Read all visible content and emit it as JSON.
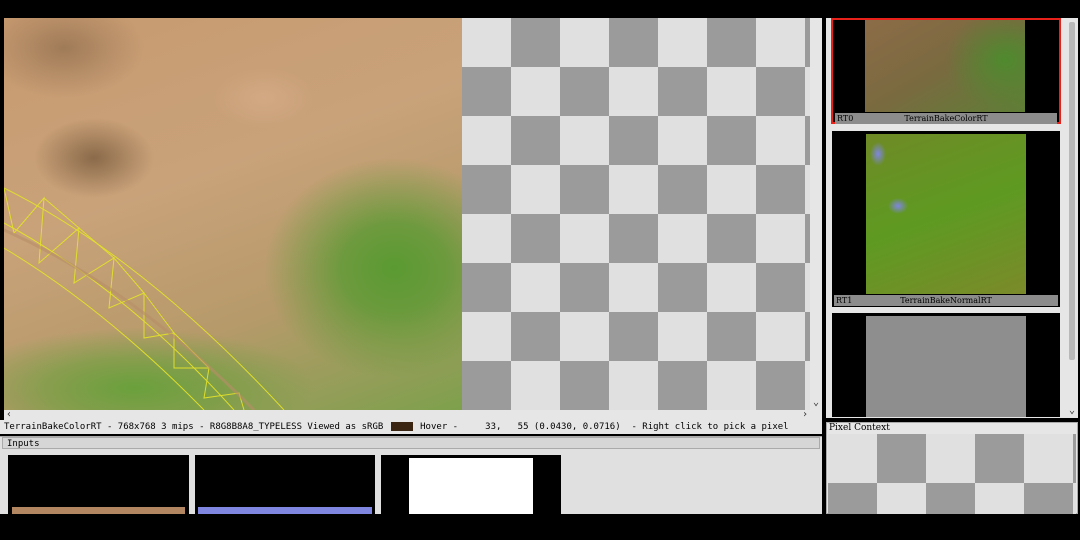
{
  "main_view": {
    "texture_name": "TerrainBakeColorRT",
    "view_label": "main-texture-view"
  },
  "status_bar": {
    "info": "TerrainBakeColorRT - 768x768 3 mips - R8G8B8A8_TYPELESS Viewed as sRGB",
    "hover": "Hover -     33,   55 (0.0430, 0.0716)  - Right click to pick a pixel",
    "swatch_color": "#3a2412"
  },
  "inputs_panel": {
    "title": "Inputs"
  },
  "outputs": [
    {
      "slot": "RT0",
      "name": "TerrainBakeColorRT",
      "selected": true
    },
    {
      "slot": "RT1",
      "name": "TerrainBakeNormalRT",
      "selected": false
    },
    {
      "slot": "",
      "name": "",
      "selected": false
    }
  ],
  "pixel_context": {
    "title": "Pixel Context"
  },
  "colors": {
    "selection_border": "#e8211a",
    "panel_bg": "#e6e6e6",
    "checker_dark": "#9b9b9b",
    "checker_light": "#e0e0e0"
  }
}
